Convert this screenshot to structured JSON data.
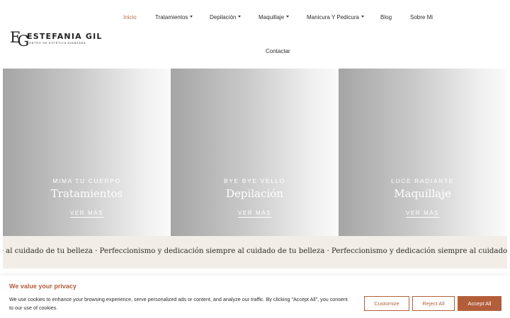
{
  "brand": {
    "name": "ESTEFANIA GIL",
    "tagline": "CENTRO DE ESTÉTICA AVANZADA",
    "monogram_e": "E",
    "monogram_g": "G"
  },
  "nav": {
    "items": [
      {
        "label": "Inicio",
        "active": true
      },
      {
        "label": "Tratamientos",
        "dropdown": true
      },
      {
        "label": "Depilación",
        "dropdown": true
      },
      {
        "label": "Maquillaje",
        "dropdown": true
      },
      {
        "label": "Manicura Y Pedicura",
        "dropdown": true
      },
      {
        "label": "Blog"
      },
      {
        "label": "Sobre Mi"
      },
      {
        "label": "Contactar"
      }
    ],
    "active_color": "#b66a43"
  },
  "cards": [
    {
      "kicker": "MIMA TU CUERPO",
      "title": "Tratamientos",
      "link": "VER MÁS"
    },
    {
      "kicker": "BYE BYE VELLO",
      "title": "Depilación",
      "link": "VER MÁS"
    },
    {
      "kicker": "LUCE RADIANTE",
      "title": "Maquillaje",
      "link": "VER MÁS"
    }
  ],
  "marquee": {
    "text": "re al cuidado de tu belleza · Perfeccionismo y dedicación siempre al cuidado de tu belleza · Perfeccionismo y dedicación siempre al cuidado de tu belleza"
  },
  "cookie": {
    "title": "We value your privacy",
    "text": "We use cookies to enhance your browsing experience, serve personalized ads or content, and analyze our traffic. By clicking \"Accept All\", you consent to our use of cookies.",
    "customize": "Customize",
    "reject": "Reject All",
    "accept": "Accept All",
    "accent_color": "#b35e3b"
  }
}
